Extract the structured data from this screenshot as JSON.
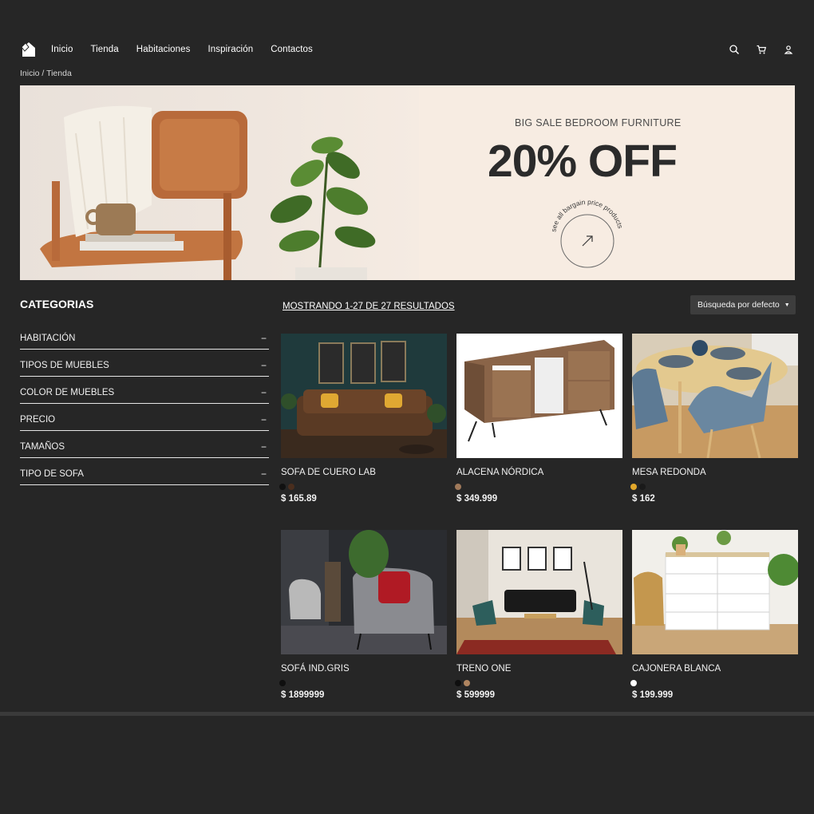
{
  "nav": {
    "links": [
      "Inicio",
      "Tienda",
      "Habitaciones",
      "Inspiración",
      "Contactos"
    ],
    "icons": [
      "search-icon",
      "cart-icon",
      "user-icon"
    ]
  },
  "breadcrumb": "Inicio / Tienda",
  "banner": {
    "subtitle": "BIG SALE BEDROOM FURNITURE",
    "headline": "20% OFF",
    "circle_text": "see all bargain price products"
  },
  "sidebar": {
    "title": "CATEGORIAS",
    "categories": [
      {
        "label": "HABITACIÓN",
        "toggle": "−"
      },
      {
        "label": "TIPOS DE MUEBLES",
        "toggle": "−"
      },
      {
        "label": "COLOR DE MUEBLES",
        "toggle": "−"
      },
      {
        "label": "PRECIO",
        "toggle": "−"
      },
      {
        "label": "TAMAÑOS",
        "toggle": "−"
      },
      {
        "label": "TIPO DE SOFA",
        "toggle": "−"
      }
    ]
  },
  "results_text": "MOSTRANDO 1-27 DE 27 RESULTADOS",
  "sort": {
    "selected": "Búsqueda por defecto"
  },
  "products": [
    {
      "name": "SOFA DE CUERO LAB",
      "price": "$ 165.89",
      "swatches": [
        "#111111",
        "#4a2e1e"
      ]
    },
    {
      "name": "ALACENA NÓRDICA",
      "price": "$ 349.999",
      "swatches": [
        "#a0795a"
      ]
    },
    {
      "name": "MESA REDONDA",
      "price": "$ 162",
      "swatches": [
        "#e3a82b",
        "#1a1a1a"
      ]
    },
    {
      "name": "SOFÁ IND.GRIS",
      "price": "$ 1899999",
      "swatches": [
        "#0f0f0f"
      ]
    },
    {
      "name": "TRENO ONE",
      "price": "$ 599999",
      "swatches": [
        "#0f0f0f",
        "#b08560"
      ]
    },
    {
      "name": "CAJONERA BLANCA",
      "price": "$ 199.999",
      "swatches": [
        "#ffffff"
      ]
    }
  ]
}
